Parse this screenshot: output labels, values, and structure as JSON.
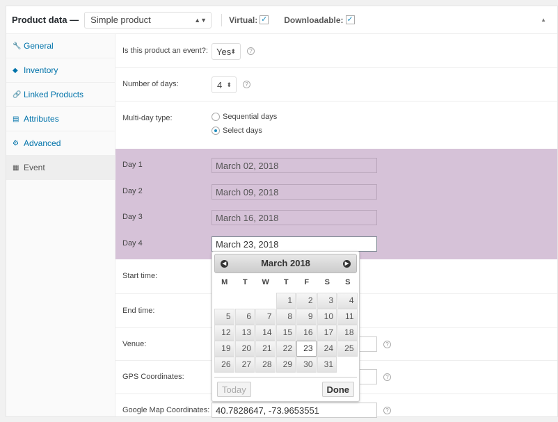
{
  "header": {
    "title": "Product data —",
    "product_type": "Simple product",
    "virtual_label": "Virtual:",
    "virtual_checked": true,
    "downloadable_label": "Downloadable:",
    "downloadable_checked": true,
    "collapse_icon": "triangle-up-icon"
  },
  "sidebar": {
    "items": [
      {
        "label": "General",
        "icon": "wrench-icon"
      },
      {
        "label": "Inventory",
        "icon": "tag-icon"
      },
      {
        "label": "Linked Products",
        "icon": "link-icon"
      },
      {
        "label": "Attributes",
        "icon": "list-icon"
      },
      {
        "label": "Advanced",
        "icon": "gear-icon"
      },
      {
        "label": "Event",
        "icon": "calendar-icon",
        "active": true
      }
    ]
  },
  "fields": {
    "is_event": {
      "label": "Is this product an event?:",
      "value": "Yes"
    },
    "num_days": {
      "label": "Number of days:",
      "value": "4"
    },
    "multi_day": {
      "label": "Multi-day type:",
      "options": [
        "Sequential days",
        "Select days"
      ],
      "selected": "Select days"
    },
    "days": [
      {
        "label": "Day 1",
        "value": "March 02, 2018"
      },
      {
        "label": "Day 2",
        "value": "March 09, 2018"
      },
      {
        "label": "Day 3",
        "value": "March 16, 2018"
      },
      {
        "label": "Day 4",
        "value": "March 23, 2018"
      }
    ],
    "start_time": {
      "label": "Start time:"
    },
    "end_time": {
      "label": "End time:"
    },
    "venue": {
      "label": "Venue:"
    },
    "gps": {
      "label": "GPS Coordinates:"
    },
    "google_map": {
      "label": "Google Map Coordinates:",
      "value": "40.7828647, -73.9653551"
    }
  },
  "datepicker": {
    "title": "March 2018",
    "weekdays": [
      "M",
      "T",
      "W",
      "T",
      "F",
      "S",
      "S"
    ],
    "leading_blanks": 3,
    "days": 31,
    "selected": 23,
    "today_label": "Today",
    "done_label": "Done"
  },
  "colors": {
    "day_highlight": "#d6c2d8",
    "link": "#0073aa"
  }
}
